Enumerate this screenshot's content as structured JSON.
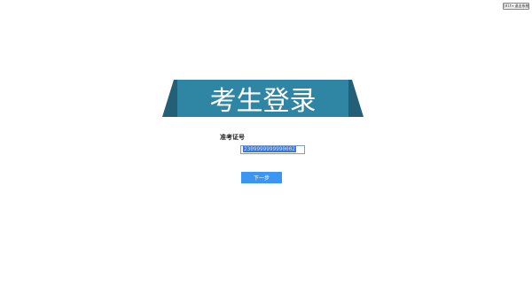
{
  "header": {
    "exit_key": "[Alt+",
    "exit_label": "退出系统"
  },
  "banner": {
    "title": "考生登录"
  },
  "form": {
    "field_label": "准考证号",
    "field_value": "2309999999990002",
    "next_label": "下一步"
  },
  "colors": {
    "banner_main": "#2f86a4",
    "banner_side": "#235f77",
    "button": "#3b95f2"
  }
}
